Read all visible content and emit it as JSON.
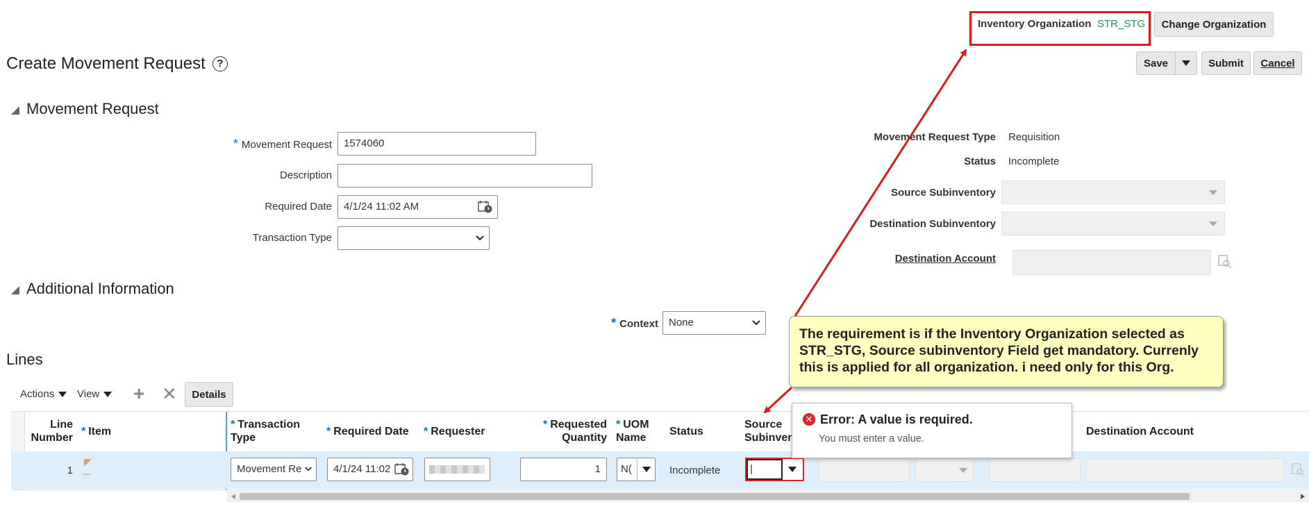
{
  "header": {
    "org_label": "Inventory Organization",
    "org_value": "STR_STG",
    "change_org_button": "Change Organization",
    "page_title": "Create Movement Request",
    "save_label": "Save",
    "submit_label": "Submit",
    "cancel_label": "Cancel"
  },
  "movement_request": {
    "section_title": "Movement Request",
    "fields": {
      "movement_request_label": "Movement Request",
      "movement_request_value": "1574060",
      "description_label": "Description",
      "description_value": "",
      "required_date_label": "Required Date",
      "required_date_value": "4/1/24 11:02 AM",
      "transaction_type_label": "Transaction Type",
      "transaction_type_value": ""
    },
    "right": {
      "type_label": "Movement Request Type",
      "type_value": "Requisition",
      "status_label": "Status",
      "status_value": "Incomplete",
      "source_sub_label": "Source Subinventory",
      "dest_sub_label": "Destination Subinventory",
      "dest_account_label": "Destination Account"
    }
  },
  "additional": {
    "section_title": "Additional Information",
    "context_label": "Context",
    "context_value": "None"
  },
  "lines": {
    "section_title": "Lines",
    "actions_label": "Actions",
    "view_label": "View",
    "details_button": "Details",
    "columns": {
      "line_number_1": "Line",
      "line_number_2": "Number",
      "item": "Item",
      "transaction_type_1": "Transaction",
      "transaction_type_2": "Type",
      "required_date": "Required Date",
      "requester": "Requester",
      "requested_qty_1": "Requested",
      "requested_qty_2": "Quantity",
      "uom_1": "UOM",
      "uom_2": "Name",
      "status": "Status",
      "source_sub_1": "Source",
      "source_sub_2": "Subinvent",
      "destination_account": "Destination Account"
    },
    "row": {
      "line_number": "1",
      "item_value": "...",
      "transaction_type": "Movement Re",
      "required_date": "4/1/24 11:02",
      "requested_qty": "1",
      "uom": "N(",
      "status": "Incomplete",
      "source_sub": "|"
    }
  },
  "error_popup": {
    "title": "Error: A value is required.",
    "message": "You must enter a value."
  },
  "callout": {
    "text": "The requirement is if the Inventory Organization selected as STR_STG, Source subinventory Field get mandatory. Currenly this is applied for all organization. i need only for this Org."
  },
  "colors": {
    "accent_blue": "#0572ce",
    "org_green": "#2e8b57",
    "annotation_red": "#e11919",
    "callout_bg": "#ffffc0",
    "row_selected": "#dfeefb",
    "error_red": "#d7262c"
  }
}
